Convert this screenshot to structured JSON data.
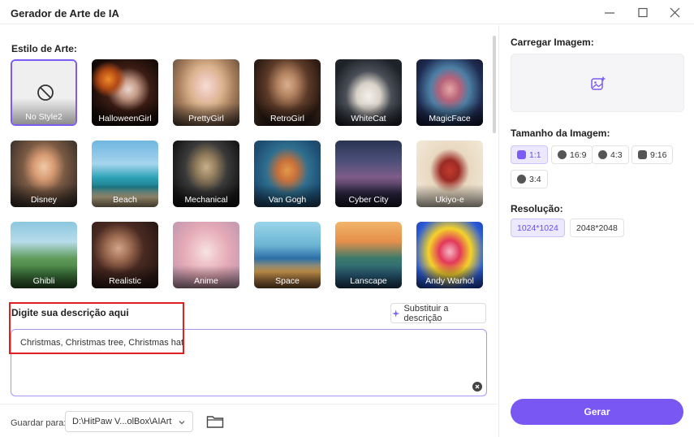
{
  "window": {
    "title": "Gerador de Arte de IA"
  },
  "left": {
    "style_label": "Estilo de Arte:",
    "styles": [
      {
        "name": "No Style2"
      },
      {
        "name": "HalloweenGirl"
      },
      {
        "name": "PrettyGirl"
      },
      {
        "name": "RetroGirl"
      },
      {
        "name": "WhiteCat"
      },
      {
        "name": "MagicFace"
      },
      {
        "name": "Disney"
      },
      {
        "name": "Beach"
      },
      {
        "name": "Mechanical"
      },
      {
        "name": "Van Gogh"
      },
      {
        "name": "Cyber City"
      },
      {
        "name": "Ukiyo-e"
      },
      {
        "name": "Ghibli"
      },
      {
        "name": "Realistic"
      },
      {
        "name": "Anime"
      },
      {
        "name": "Space"
      },
      {
        "name": "Lanscape"
      },
      {
        "name": "Andy Warhol"
      }
    ],
    "selected_style": "No Style2",
    "description_label": "Digite sua descrição aqui",
    "replace_button": "Substituir a descrição",
    "prompt_value": "Christmas, Christmas tree, Christmas hat"
  },
  "footer": {
    "save_label": "Guardar para:",
    "save_path": "D:\\HitPaw V...olBox\\AIArt"
  },
  "right": {
    "upload_label": "Carregar Imagem:",
    "size_label": "Tamanho da Imagem:",
    "sizes": [
      "1:1",
      "16:9",
      "4:3",
      "9:16",
      "3:4"
    ],
    "selected_size": "1:1",
    "resolution_label": "Resolução:",
    "resolutions": [
      "1024*1024",
      "2048*2048"
    ],
    "selected_resolution": "1024*1024",
    "generate_button": "Gerar"
  },
  "colors": {
    "accent": "#7957f2",
    "accent_light": "#ece8fd",
    "highlight_box": "#e02020"
  }
}
